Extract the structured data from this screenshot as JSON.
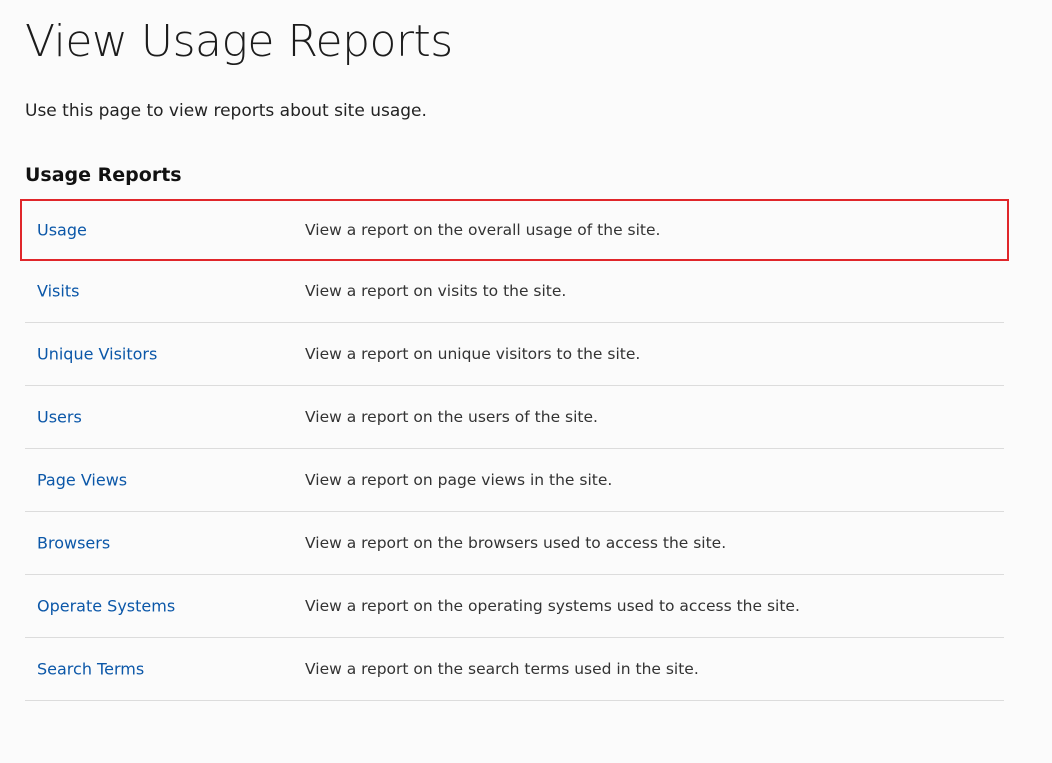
{
  "page": {
    "title": "View Usage Reports",
    "description": "Use this page to view reports about site usage."
  },
  "section": {
    "heading": "Usage Reports"
  },
  "reports": [
    {
      "label": "Usage",
      "description": "View a report on the overall usage of the site."
    },
    {
      "label": "Visits",
      "description": "View a report on visits to the site."
    },
    {
      "label": "Unique Visitors",
      "description": "View a report on unique visitors to the site."
    },
    {
      "label": "Users",
      "description": "View a report on the users of the site."
    },
    {
      "label": "Page Views",
      "description": "View a report on page views in the site."
    },
    {
      "label": "Browsers",
      "description": "View a report on the browsers used to access the site."
    },
    {
      "label": "Operate Systems",
      "description": "View a report on the operating systems used to access the site."
    },
    {
      "label": "Search Terms",
      "description": "View a report on the search terms used in the site."
    }
  ],
  "colors": {
    "link": "#0b57a8",
    "highlight_border": "#e0262a",
    "divider": "#dcdcdc"
  }
}
